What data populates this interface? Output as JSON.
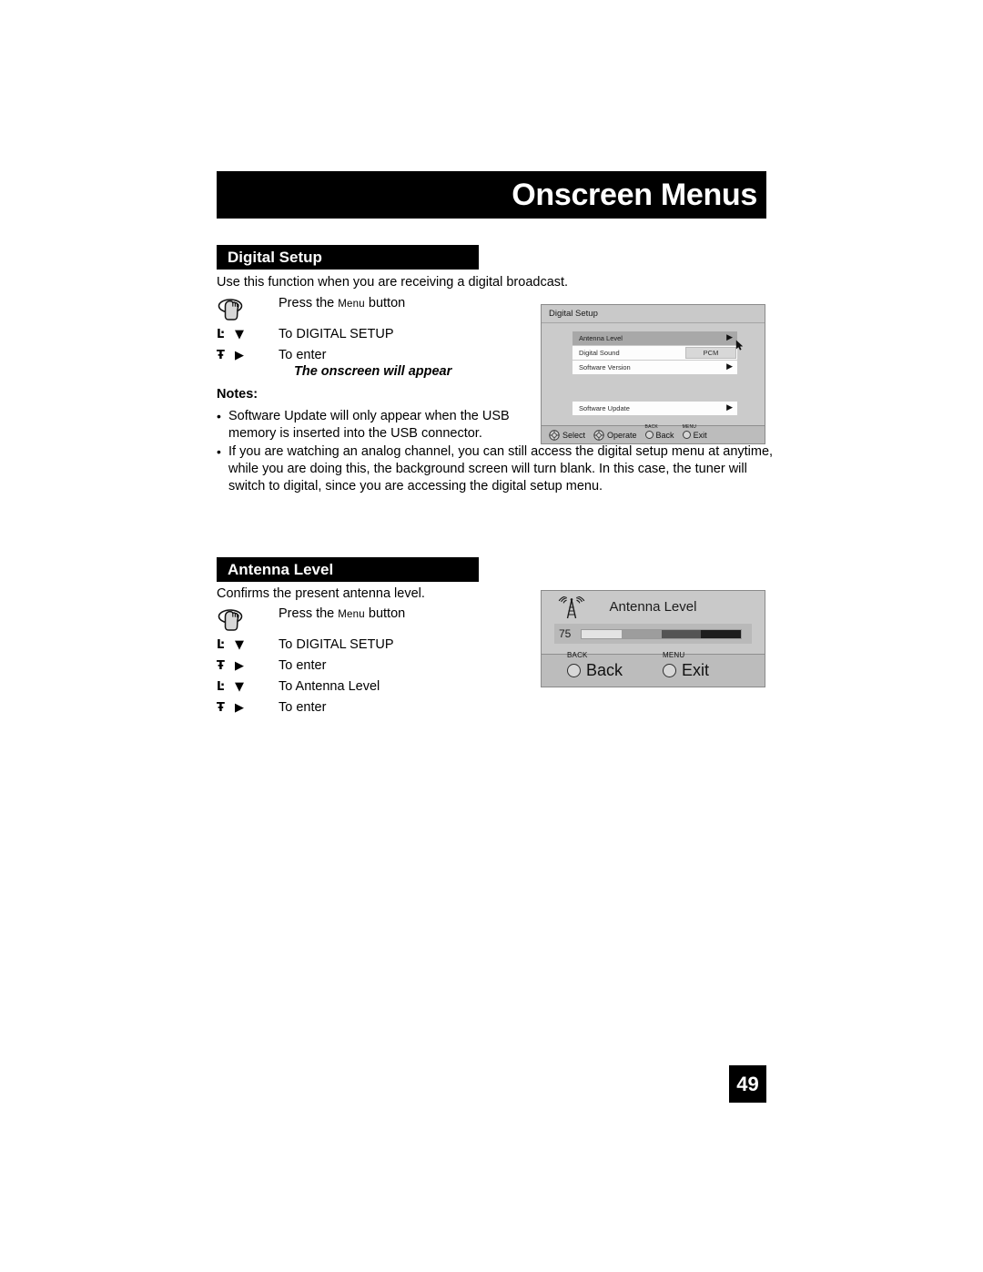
{
  "page": {
    "header_title": "Onscreen Menus",
    "page_number": "49"
  },
  "digital_setup": {
    "section_title": "Digital Setup",
    "intro": "Use this function when you are receiving a digital broadcast.",
    "steps": [
      {
        "icon": "hand-press-icon",
        "label_pre": "Press the ",
        "label_sc": "Menu",
        "label_post": " button"
      },
      {
        "icon": "down-arrow-icon",
        "label": "To DIGITAL SETUP"
      },
      {
        "icon": "right-arrow-icon",
        "label": "To enter"
      }
    ],
    "onscreen_note": "The onscreen will appear",
    "notes_label": "Notes:",
    "notes": [
      "Software Update will only appear when the USB memory is inserted into the USB connector.",
      "If you are watching an analog channel, you can still access the digital setup menu at anytime, while you are doing this, the background screen will turn blank.  In this case, the tuner will switch to digital, since you are accessing the digital setup menu."
    ],
    "osd": {
      "title": "Digital Setup",
      "rows": [
        {
          "label": "Antenna Level",
          "type": "arrow",
          "selected": true
        },
        {
          "label": "Digital Sound",
          "type": "value",
          "value": "PCM",
          "selected": false
        },
        {
          "label": "Software Version",
          "type": "arrow",
          "selected": false
        },
        {
          "label": "Software Update",
          "type": "arrow",
          "selected": false
        }
      ],
      "nav": [
        {
          "sup": "",
          "icon": "dpad-icon",
          "label": "Select"
        },
        {
          "sup": "",
          "icon": "dpad-icon",
          "label": "Operate"
        },
        {
          "sup": "BACK",
          "icon": "circle-icon",
          "label": "Back"
        },
        {
          "sup": "MENU",
          "icon": "circle-icon",
          "label": "Exit"
        }
      ]
    }
  },
  "antenna_level": {
    "section_title": "Antenna Level",
    "intro": "Confirms the present antenna level.",
    "steps": [
      {
        "icon": "hand-press-icon",
        "label_pre": "Press the ",
        "label_sc": "Menu",
        "label_post": " button"
      },
      {
        "icon": "down-arrow-icon",
        "label": "To DIGITAL SETUP"
      },
      {
        "icon": "right-arrow-icon",
        "label": "To enter"
      },
      {
        "icon": "down-arrow-icon",
        "label": "To Antenna Level"
      },
      {
        "icon": "right-arrow-icon",
        "label": "To enter"
      }
    ],
    "osd": {
      "heading": "Antenna Level",
      "value": "75",
      "meter_segments": [
        "#e4e4e4",
        "#9d9d9d",
        "#545454",
        "#1d1d1d"
      ],
      "nav": [
        {
          "sup": "BACK",
          "label": "Back"
        },
        {
          "sup": "MENU",
          "label": "Exit"
        }
      ]
    }
  },
  "colors": {
    "bar_black": "#000000",
    "osd_bg": "#c8c8c8",
    "osd_selected": "#a8a8a8",
    "osd_row_white": "#fdfdfd",
    "osd_nav_bg": "#bcbcbc"
  }
}
